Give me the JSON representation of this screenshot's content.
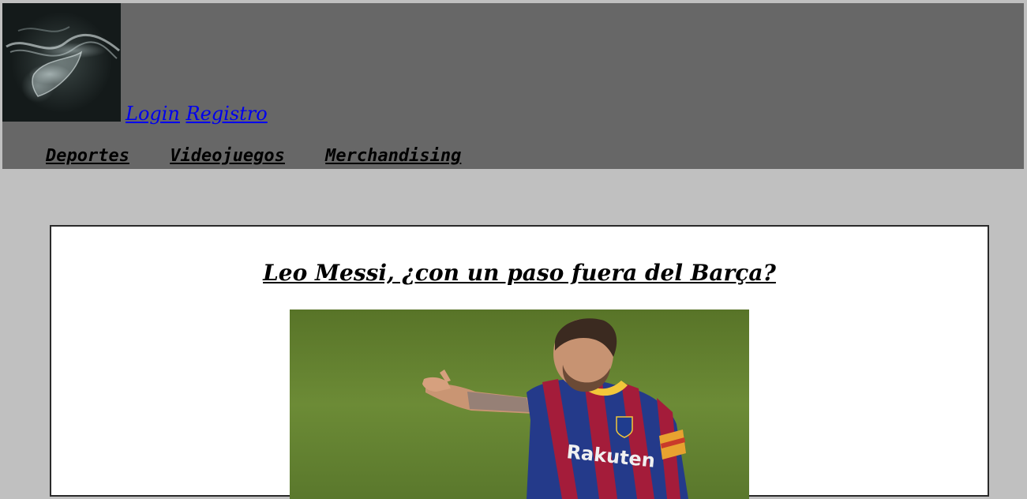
{
  "header": {
    "logo_icon": "smoke-logo-icon",
    "auth": {
      "login_label": "Login",
      "register_label": "Registro"
    },
    "nav": [
      {
        "label": "Deportes"
      },
      {
        "label": "Videojuegos"
      },
      {
        "label": "Merchandising"
      }
    ]
  },
  "article": {
    "title": "Leo Messi, ¿con un paso fuera del Barça?",
    "photo": {
      "jersey_sponsor": "Rakuten"
    }
  },
  "colors": {
    "page_bg": "#c0c0c0",
    "header_bg": "#676767",
    "link": "#0000ee",
    "article_bg": "#ffffff"
  }
}
